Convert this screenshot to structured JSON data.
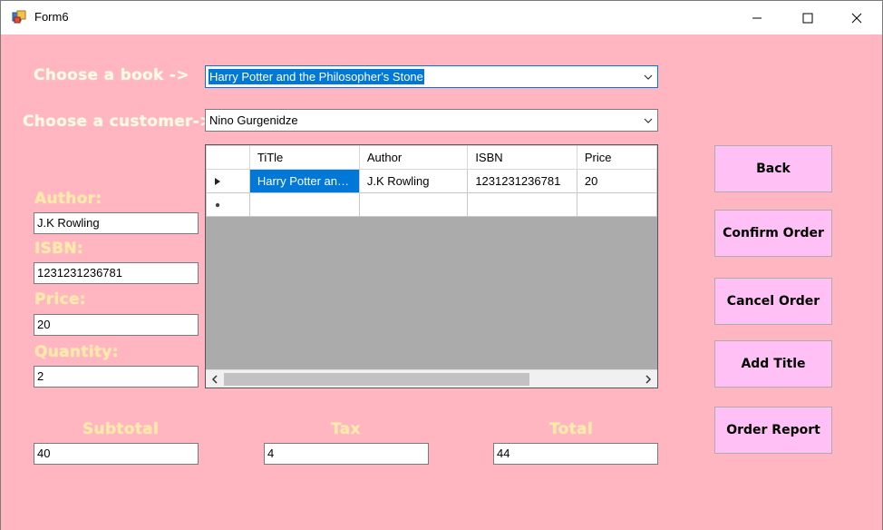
{
  "window": {
    "title": "Form6"
  },
  "book": {
    "label": "Choose a book ->",
    "selected": "Harry Potter and the Philosopher's Stone"
  },
  "customer": {
    "label": "Choose a customer->",
    "selected": "Nino Gurgenidze"
  },
  "details": {
    "author_label": "Author:",
    "author_value": "J.K Rowling",
    "isbn_label": "ISBN:",
    "isbn_value": "1231231236781",
    "price_label": "Price:",
    "price_value": "20",
    "quantity_label": "Quantity:",
    "quantity_value": "2"
  },
  "grid": {
    "columns": [
      "TiTle",
      "Author",
      "ISBN",
      "Price"
    ],
    "rows": [
      [
        "Harry Potter and t...",
        "J.K Rowling",
        "1231231236781",
        "20"
      ]
    ]
  },
  "totals": {
    "subtotal_label": "Subtotal",
    "subtotal_value": "40",
    "tax_label": "Tax",
    "tax_value": "4",
    "total_label": "Total",
    "total_value": "44"
  },
  "buttons": {
    "back": "Back",
    "confirm": "Confirm Order",
    "cancel": "Cancel Order",
    "add_title": "Add Title",
    "report": "Order Report"
  },
  "icons": {
    "app": "form-icon",
    "minimize": "minimize-icon",
    "maximize": "maximize-icon",
    "close": "close-icon"
  }
}
